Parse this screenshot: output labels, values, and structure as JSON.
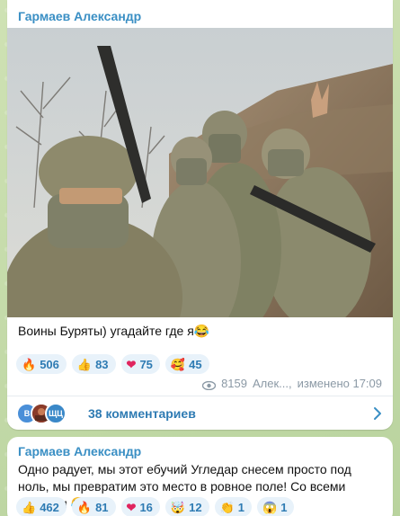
{
  "posts": [
    {
      "author": "Гармаев Александр",
      "caption": "Воины Буряты) угадайте где я",
      "caption_emoji": "😂",
      "reactions": [
        {
          "icon": "fire-icon",
          "glyph": "🔥",
          "count": "506"
        },
        {
          "icon": "thumbs-up-icon",
          "glyph": "👍",
          "count": "83"
        },
        {
          "icon": "heart-icon",
          "glyph": "❤",
          "count": "75"
        },
        {
          "icon": "smiling-face-with-hearts-icon",
          "glyph": "🥰",
          "count": "45"
        }
      ],
      "views": "8159",
      "signature": "Алек...",
      "edited": "изменено 17:09",
      "comments": {
        "avatars": [
          "В",
          "",
          "ЩЦ"
        ],
        "label": "38 комментариев"
      }
    },
    {
      "author": "Гармаев Александр",
      "text": "Одно радует, мы этот ебучий Угледар снесем просто под ноль, мы превратим это место в ровное поле! Со всеми хохлами",
      "text_emoji": "😂",
      "reactions": [
        {
          "icon": "thumbs-up-icon",
          "glyph": "👍",
          "count": "462"
        },
        {
          "icon": "fire-icon",
          "glyph": "🔥",
          "count": "81"
        },
        {
          "icon": "heart-icon",
          "glyph": "❤",
          "count": "16"
        },
        {
          "icon": "exploding-head-icon",
          "glyph": "🤯",
          "count": "12"
        },
        {
          "icon": "clapping-hands-icon",
          "glyph": "👏",
          "count": "1"
        },
        {
          "icon": "screaming-face-icon",
          "glyph": "😱",
          "count": "1"
        }
      ]
    }
  ],
  "colors": {
    "accent": "#3a8fc4",
    "reaction_bg": "#e8f2fa",
    "reaction_text": "#2e7bb3",
    "meta": "#8b99a5",
    "chat_bg": "#c8dcb0",
    "avatar_colors": [
      "#4a8fd8",
      "#8a3b2a",
      "#3a88c8"
    ]
  }
}
